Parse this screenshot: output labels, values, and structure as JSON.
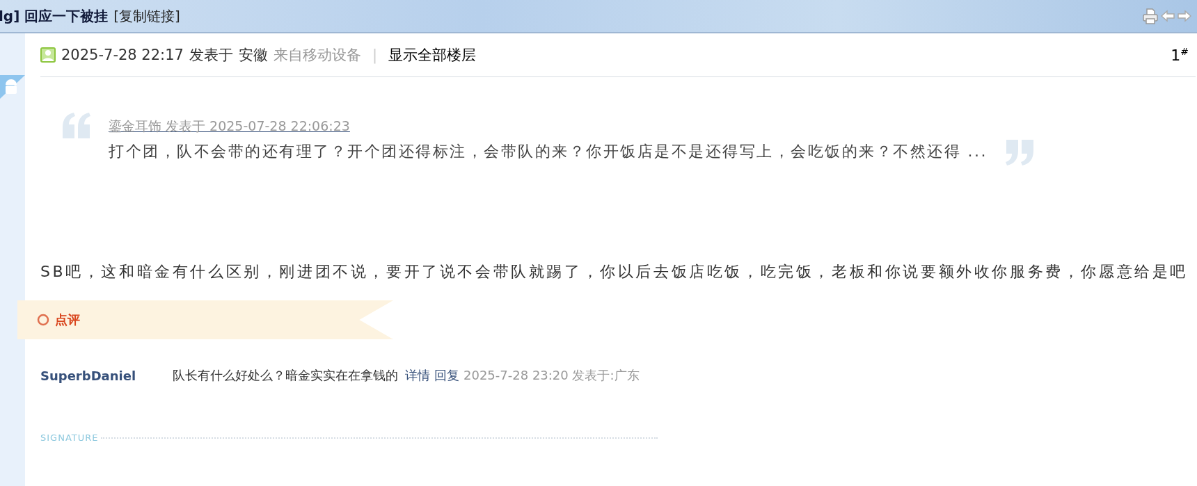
{
  "title_bar": {
    "title": "lg] 回应一下被挂",
    "copy_link": "[复制链接]"
  },
  "post": {
    "datetime": "2025-7-28 22:17",
    "posted_label": "发表于",
    "location": "安徽",
    "source": "来自移动设备",
    "separator": "|",
    "show_all_floors": "显示全部楼层",
    "floor": "1",
    "floor_mark": "#",
    "quote": {
      "author_line": "鎏金耳饰 发表于 2025-07-28 22:06:23",
      "text": "打个团，队不会带的还有理了？开个团还得标注，会带队的来？你开饭店是不是还得写上，会吃饭的来？不然还得 ..."
    },
    "body": "SB吧，这和暗金有什么区别，刚进团不说，要开了说不会带队就踢了，你以后去饭店吃饭，吃完饭，老板和你说要额外收你服务费，你愿意给是吧"
  },
  "comments": {
    "title": "点评",
    "items": [
      {
        "user": "SuperbDaniel",
        "text": "队长有什么好处么？暗金实实在在拿钱的",
        "details_link": "详情",
        "reply_link": "回复",
        "meta": "2025-7-28 23:20 发表于:广东"
      }
    ]
  },
  "signature_label": "SIGNATURE"
}
